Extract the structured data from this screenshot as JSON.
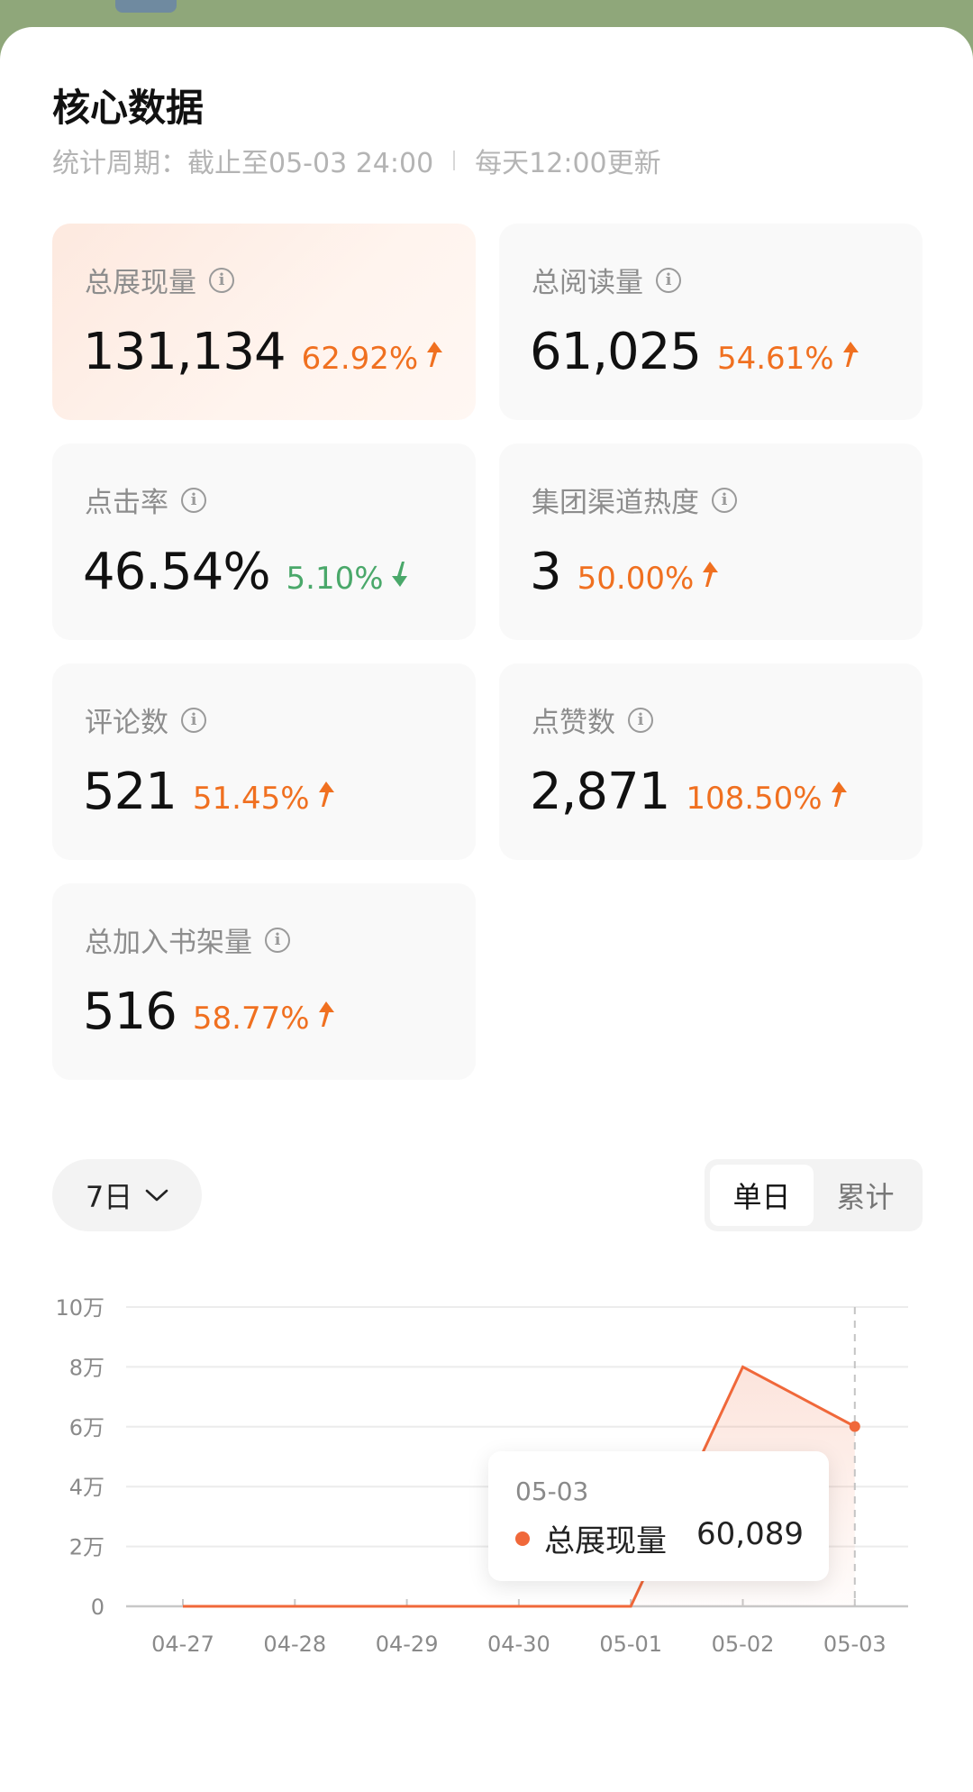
{
  "header": {
    "title": "核心数据",
    "period": "统计周期：截止至05-03 24:00",
    "update": "每天12:00更新"
  },
  "metrics": [
    {
      "label": "总展现量",
      "value": "131,134",
      "change": "62.92%",
      "direction": "up"
    },
    {
      "label": "总阅读量",
      "value": "61,025",
      "change": "54.61%",
      "direction": "up"
    },
    {
      "label": "点击率",
      "value": "46.54%",
      "change": "5.10%",
      "direction": "down"
    },
    {
      "label": "集团渠道热度",
      "value": "3",
      "change": "50.00%",
      "direction": "up"
    },
    {
      "label": "评论数",
      "value": "521",
      "change": "51.45%",
      "direction": "up"
    },
    {
      "label": "点赞数",
      "value": "2,871",
      "change": "108.50%",
      "direction": "up"
    },
    {
      "label": "总加入书架量",
      "value": "516",
      "change": "58.77%",
      "direction": "up"
    }
  ],
  "controls": {
    "range": "7日",
    "mode_single": "单日",
    "mode_cumulative": "累计"
  },
  "colors": {
    "accent": "#f07020",
    "down": "#4aa86a",
    "line": "#f0683a"
  },
  "chart_data": {
    "type": "line",
    "categories": [
      "04-27",
      "04-28",
      "04-29",
      "04-30",
      "05-01",
      "05-02",
      "05-03"
    ],
    "series": [
      {
        "name": "总展现量",
        "values": [
          0,
          0,
          0,
          0,
          0,
          80000,
          60089
        ]
      }
    ],
    "yticks": [
      "0",
      "2万",
      "4万",
      "6万",
      "8万",
      "10万"
    ],
    "ylim": [
      0,
      100000
    ],
    "grid": true,
    "tooltip": {
      "date": "05-03",
      "name": "总展现量",
      "value": "60,089"
    }
  }
}
